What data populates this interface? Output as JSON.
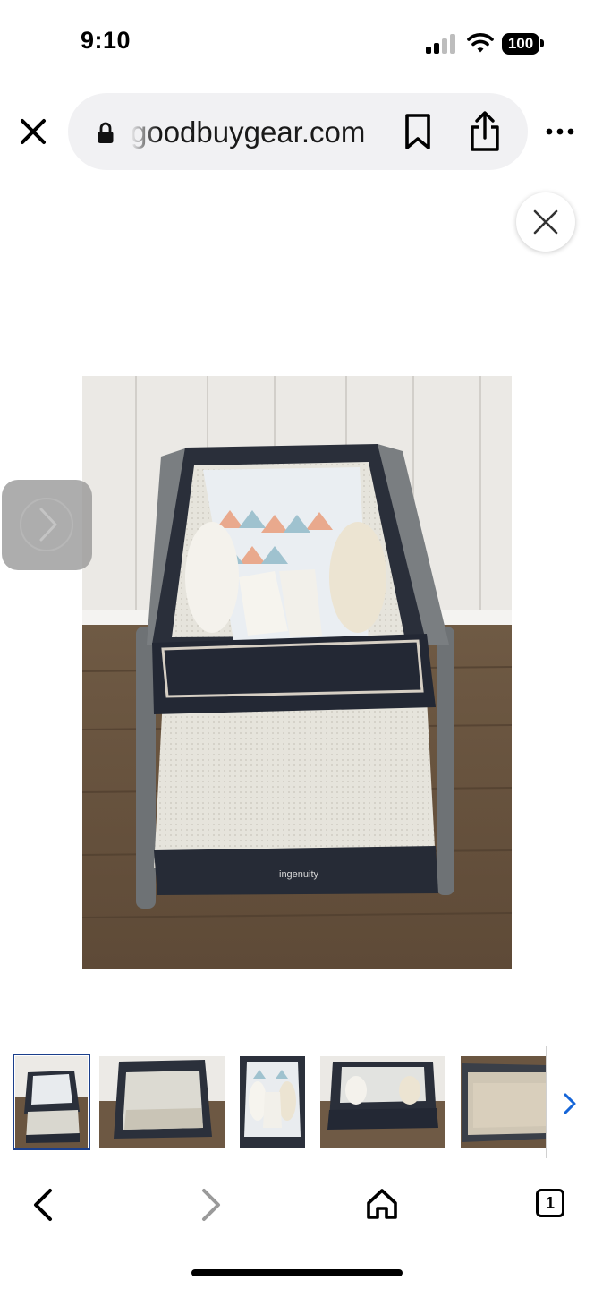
{
  "status_bar": {
    "time": "9:10",
    "battery": "100",
    "icons": [
      "cellular-signal-icon",
      "wifi-icon",
      "battery-icon"
    ]
  },
  "toolbar": {
    "close_icon": "close-icon",
    "url": "goodbuygear.com",
    "lock_icon": "lock-icon",
    "bookmark_icon": "bookmark-icon",
    "share_icon": "share-icon",
    "more_icon": "more-icon"
  },
  "viewer": {
    "close_icon": "close-icon",
    "next_icon": "chevron-right-icon",
    "photo_brand_text": "ingenuity",
    "thumbnail_count_visible": 5,
    "selected_thumbnail": 1,
    "strip_next_icon": "chevron-right-icon"
  },
  "bottom_bar": {
    "back_icon": "chevron-left-icon",
    "forward_icon": "chevron-right-icon",
    "home_icon": "home-icon",
    "tab_count": "1"
  },
  "colors": {
    "url_pill": "#f1f1f3",
    "selected_thumb_border": "#1b3f8c",
    "strip_next_arrow": "#1565d8",
    "forward_disabled": "#9a9a9a"
  }
}
